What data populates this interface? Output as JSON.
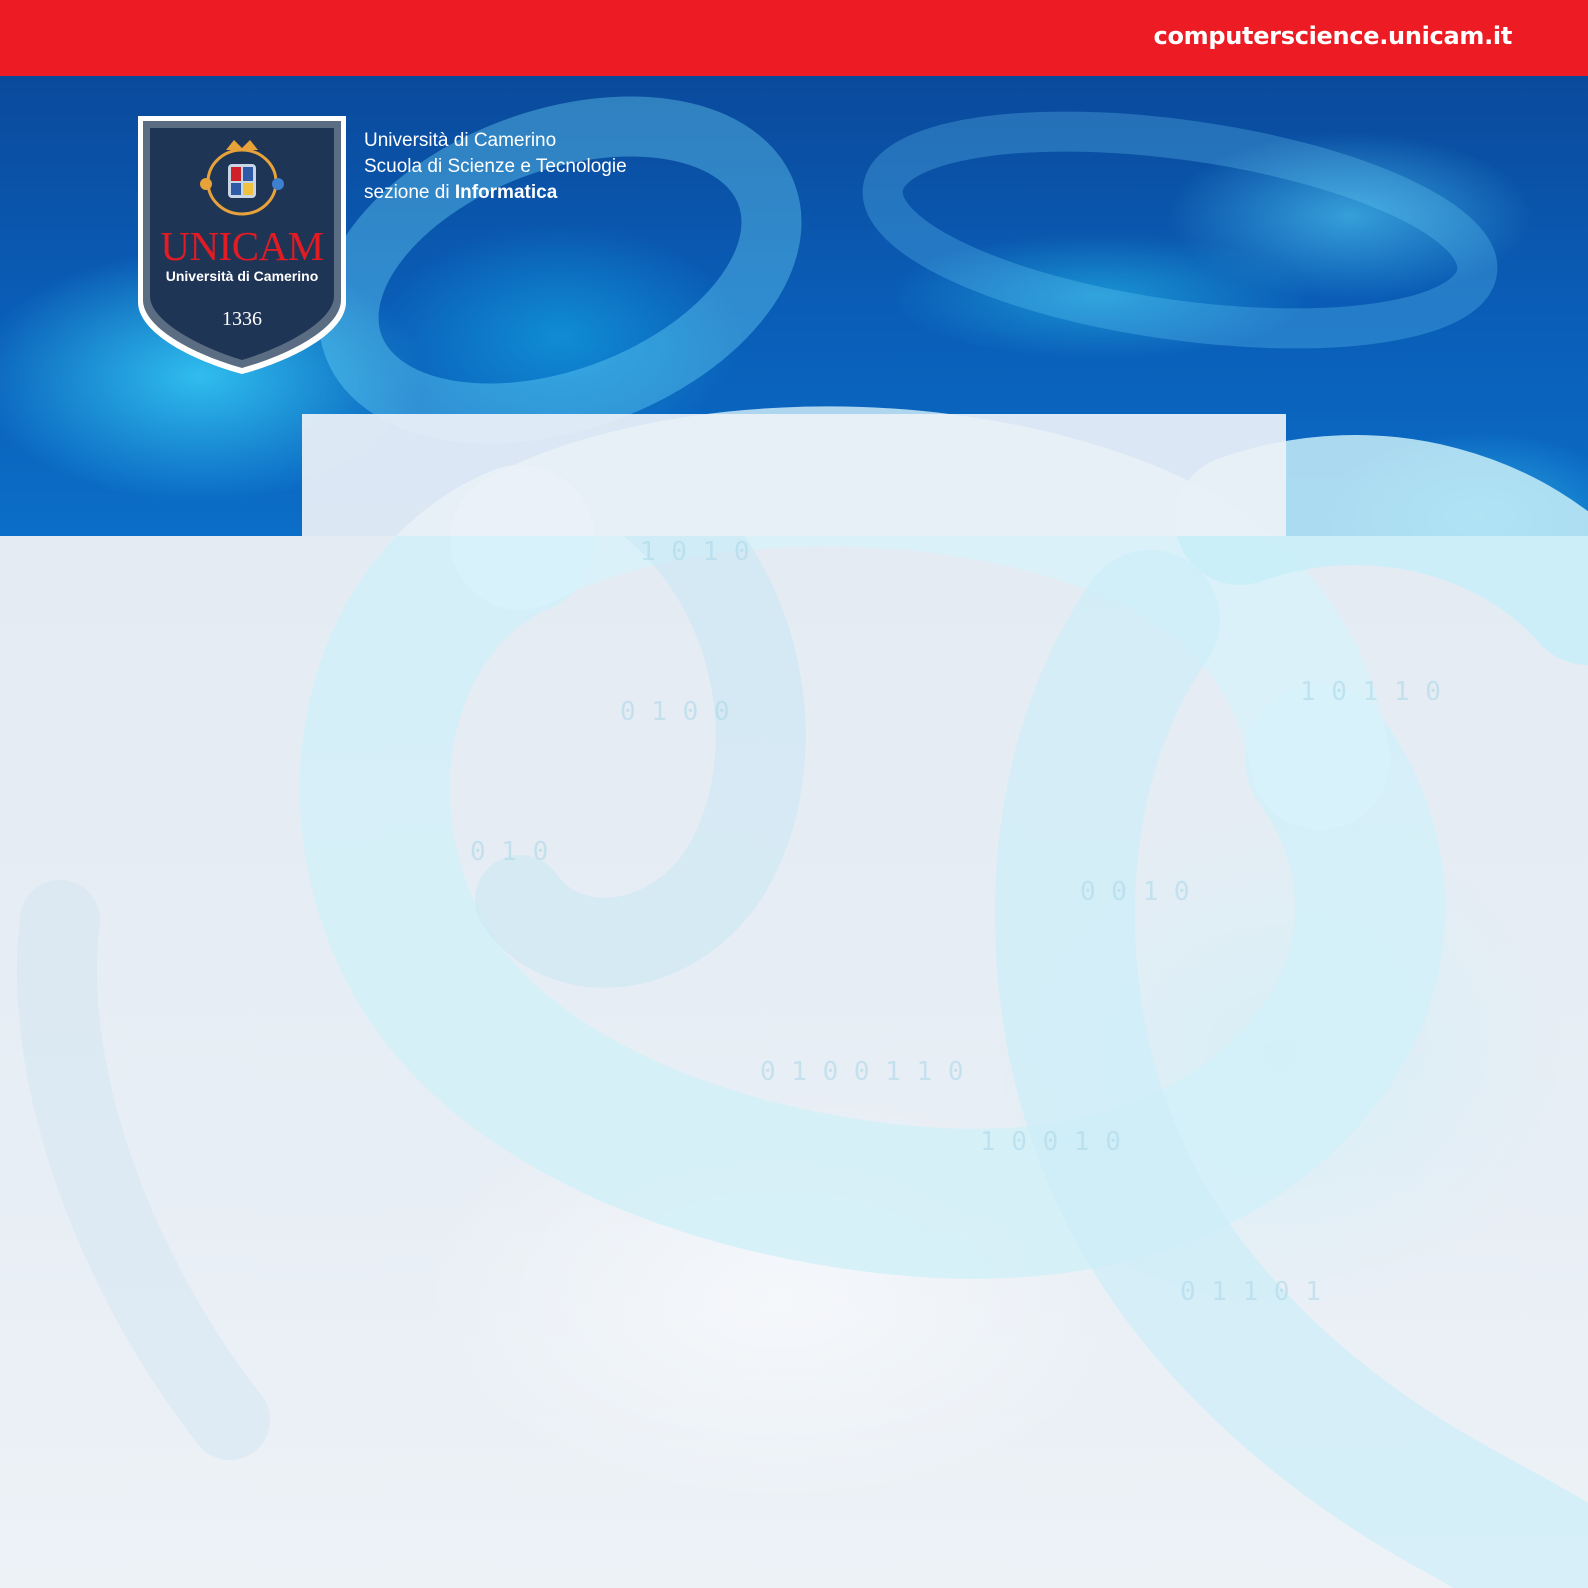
{
  "header": {
    "site_url": "computerscience.unicam.it",
    "bar_color": "#ed1c24"
  },
  "logo": {
    "name": "UNICAM",
    "subtitle": "Università di Camerino",
    "year": "1336",
    "shield_color": "#1e3a5f",
    "name_color": "#e31b23"
  },
  "institution": {
    "line1": "Università di Camerino",
    "line2": "Scuola di Scienze e Tecnologie",
    "line3_prefix": "sezione di ",
    "line3_bold": "Informatica"
  },
  "background": {
    "hero_motif": "digital-chain-links-binary",
    "hero_color": "#0a5bb4",
    "panel_color": "#e8edf3"
  }
}
